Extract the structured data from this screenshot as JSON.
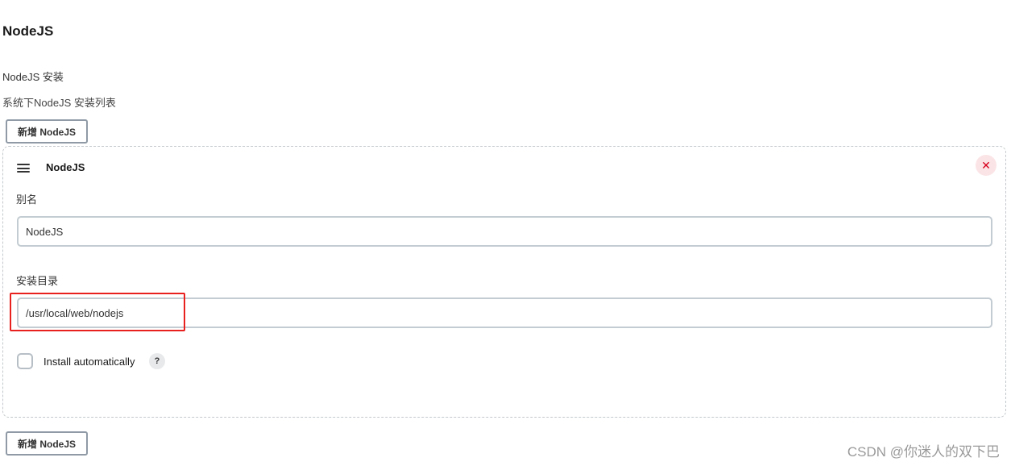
{
  "section": {
    "title": "NodeJS",
    "label": "NodeJS 安装",
    "description": "系统下NodeJS 安装列表"
  },
  "buttons": {
    "add_top_label": "新增 NodeJS",
    "add_bottom_label": "新增 NodeJS"
  },
  "installation": {
    "title": "NodeJS",
    "close_icon": "✕",
    "alias_label": "别名",
    "alias_value": "NodeJS",
    "dir_label": "安装目录",
    "dir_value": "/usr/local/web/nodejs",
    "install_auto_label": "Install automatically",
    "install_auto_checked": false,
    "help_icon": "?"
  },
  "watermark": "CSDN @你迷人的双下巴",
  "colors": {
    "highlight": "#e8201e",
    "close_bg": "#fbe4e6",
    "close_fg": "#d6001c"
  }
}
